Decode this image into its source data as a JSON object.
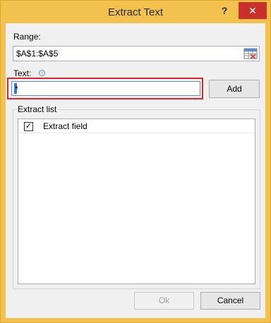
{
  "window": {
    "title": "Extract Text",
    "help_label": "?",
    "close_label": "✕"
  },
  "range": {
    "label": "Range:",
    "value": "$A$1:$A$5"
  },
  "text": {
    "label": "Text:",
    "value": "*",
    "info_glyph": "i"
  },
  "buttons": {
    "add": "Add",
    "ok": "Ok",
    "cancel": "Cancel"
  },
  "extract_list": {
    "title": "Extract list",
    "items": [
      {
        "label": "Extract field",
        "checked": true
      }
    ]
  },
  "colors": {
    "title_bar": "#f2c14e",
    "close_button": "#c9302c",
    "highlight": "#e32626",
    "selection": "#3a78d8"
  }
}
